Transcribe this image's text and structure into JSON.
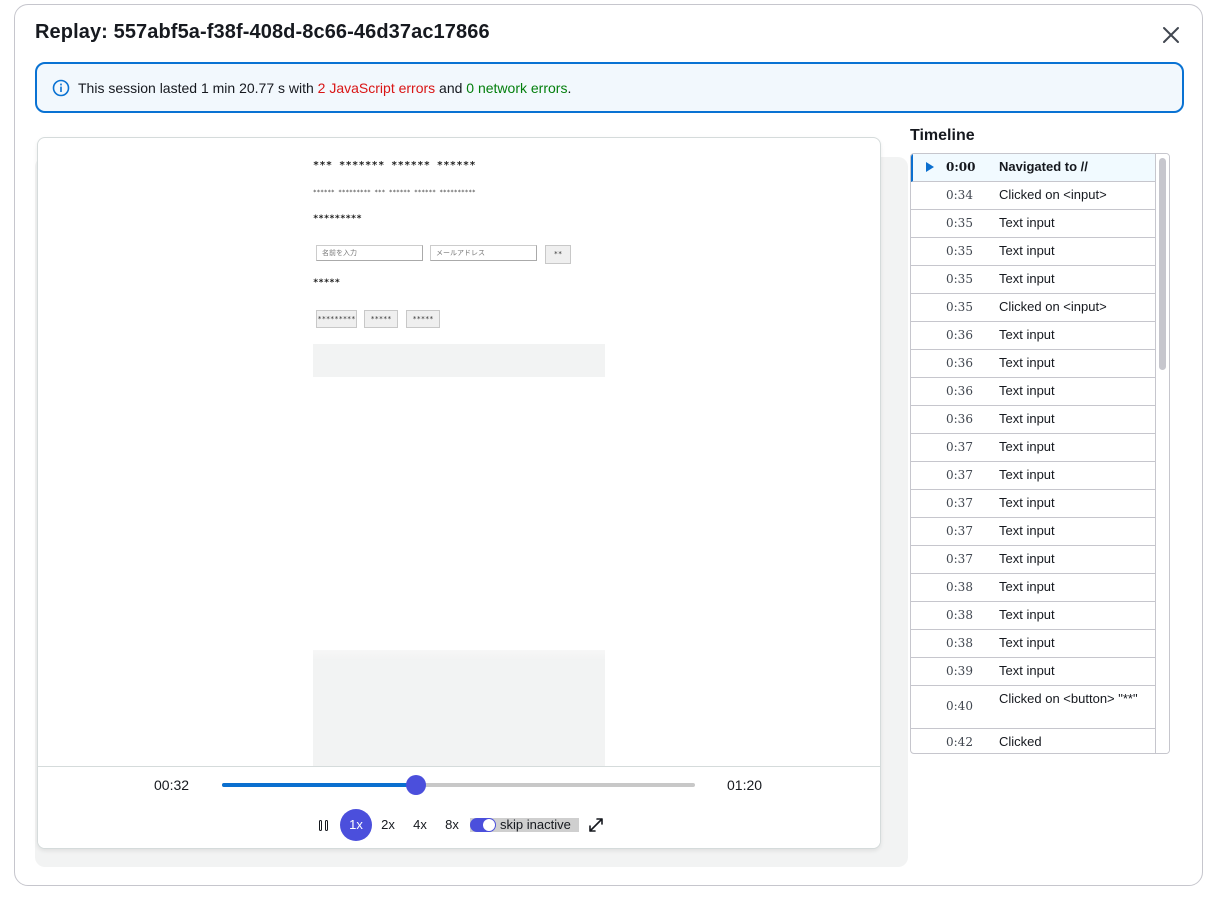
{
  "modal": {
    "title": "Replay: 557abf5a-f38f-408d-8c66-46d37ac17866"
  },
  "alert": {
    "prefix": "This session lasted 1 min 20.77 s with ",
    "js_errors": "2 JavaScript errors",
    "middle": " and ",
    "network_errors": "0 network errors",
    "suffix": "."
  },
  "replay_page": {
    "heading": "*** ******* ****** ******",
    "subtext": "****** ********* *** ****** ****** **********",
    "section1_heading": "*********",
    "name_placeholder": "名前を入力",
    "email_placeholder": "メールアドレス",
    "submit_label": "**",
    "section2_heading": "*****",
    "buttons": [
      "*********",
      "*****",
      "*****"
    ]
  },
  "player": {
    "current_time": "00:32",
    "total_time": "01:20",
    "progress": 0.41,
    "speeds": [
      "1x",
      "2x",
      "4x",
      "8x"
    ],
    "active_speed": "1x",
    "skip_inactive_label": "skip inactive",
    "skip_inactive_on": true
  },
  "timeline": {
    "title": "Timeline",
    "events": [
      {
        "time": "0:00",
        "label": "Navigated to //",
        "active": true
      },
      {
        "time": "0:34",
        "label": "Clicked on <input>"
      },
      {
        "time": "0:35",
        "label": "Text input"
      },
      {
        "time": "0:35",
        "label": "Text input"
      },
      {
        "time": "0:35",
        "label": "Text input"
      },
      {
        "time": "0:35",
        "label": "Clicked on <input>"
      },
      {
        "time": "0:36",
        "label": "Text input"
      },
      {
        "time": "0:36",
        "label": "Text input"
      },
      {
        "time": "0:36",
        "label": "Text input"
      },
      {
        "time": "0:36",
        "label": "Text input"
      },
      {
        "time": "0:37",
        "label": "Text input"
      },
      {
        "time": "0:37",
        "label": "Text input"
      },
      {
        "time": "0:37",
        "label": "Text input"
      },
      {
        "time": "0:37",
        "label": "Text input"
      },
      {
        "time": "0:37",
        "label": "Text input"
      },
      {
        "time": "0:38",
        "label": "Text input"
      },
      {
        "time": "0:38",
        "label": "Text input"
      },
      {
        "time": "0:38",
        "label": "Text input"
      },
      {
        "time": "0:39",
        "label": "Text input"
      },
      {
        "time": "0:40",
        "label": "Clicked on <button> \"**\"",
        "tall": true
      },
      {
        "time": "0:42",
        "label": "Clicked"
      }
    ]
  },
  "colors": {
    "accent": "#4b4fdc",
    "progress_fill": "#0b6fcf",
    "error": "#d91515",
    "success": "#037f0c",
    "info_border": "#0972d3"
  },
  "icons": {
    "close": "close-icon",
    "info": "info-icon",
    "pause": "pause-icon",
    "fullscreen": "fullscreen-icon",
    "play_marker": "play-triangle-icon"
  }
}
